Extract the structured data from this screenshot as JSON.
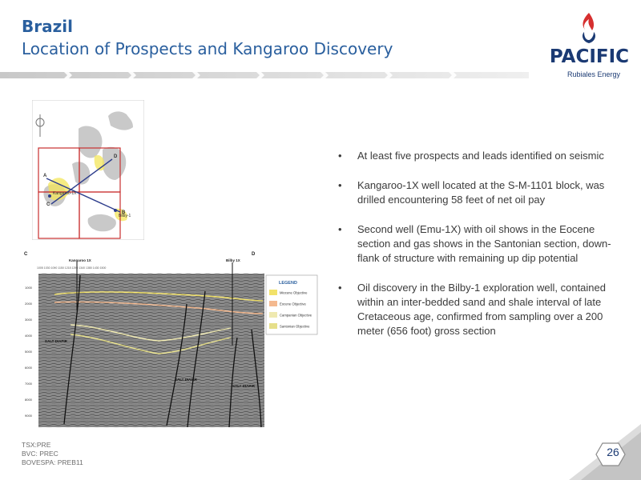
{
  "header": {
    "title": "Brazil",
    "subtitle": "Location of Prospects and Kangaroo Discovery"
  },
  "logo": {
    "word": "PACIFIC",
    "tagline": "Rubiales Energy",
    "colors": {
      "flame_red": "#d62f2f",
      "navy": "#1b3a73"
    }
  },
  "colors": {
    "title_blue": "#2a5f9e",
    "body_text": "#3b3b3b",
    "band_gray": "#d9d9d9"
  },
  "map": {
    "labels": [
      "Kangaroo-1X",
      "Bilby-1"
    ],
    "line_labels": [
      "A",
      "B",
      "C",
      "D"
    ]
  },
  "section": {
    "left_label": "C",
    "right_label": "D",
    "well_left": "Kangaroo 1X",
    "well_right": "Bilby 1X",
    "depth_ticks": [
      "1000",
      "2000",
      "3000",
      "4000",
      "5000",
      "6000",
      "7000",
      "8000",
      "9000"
    ],
    "salt_labels": [
      "SALT DIAPIR",
      "SALT DIAPIR",
      "SALT DIAPIR"
    ],
    "legend": {
      "title": "LEGEND",
      "items": [
        {
          "label": "Miocene Objective",
          "color": "#f2e26a"
        },
        {
          "label": "Eocene Objective",
          "color": "#f4b98f"
        },
        {
          "label": "Campanian Objective",
          "color": "#efe9b0"
        },
        {
          "label": "Santonian Objective",
          "color": "#e6df8a"
        }
      ]
    }
  },
  "bullets": [
    "At least five prospects and leads identified on seismic",
    "Kangaroo-1X well located at the S-M-1101 block, was drilled encountering 58 feet of net oil pay",
    "Second well (Emu-1X) with oil shows in the Eocene section and gas shows in the Santonian section, down-flank of structure with remaining up dip potential",
    "Oil discovery in the Bilby-1 exploration well, contained within an inter-bedded sand and shale interval of late Cretaceous age, confirmed from sampling over a 200 meter (656 foot) gross section"
  ],
  "footer": {
    "tickers": [
      "TSX:PRE",
      "BVC: PREC",
      "BOVESPA: PREB11"
    ],
    "page_number": "26"
  }
}
